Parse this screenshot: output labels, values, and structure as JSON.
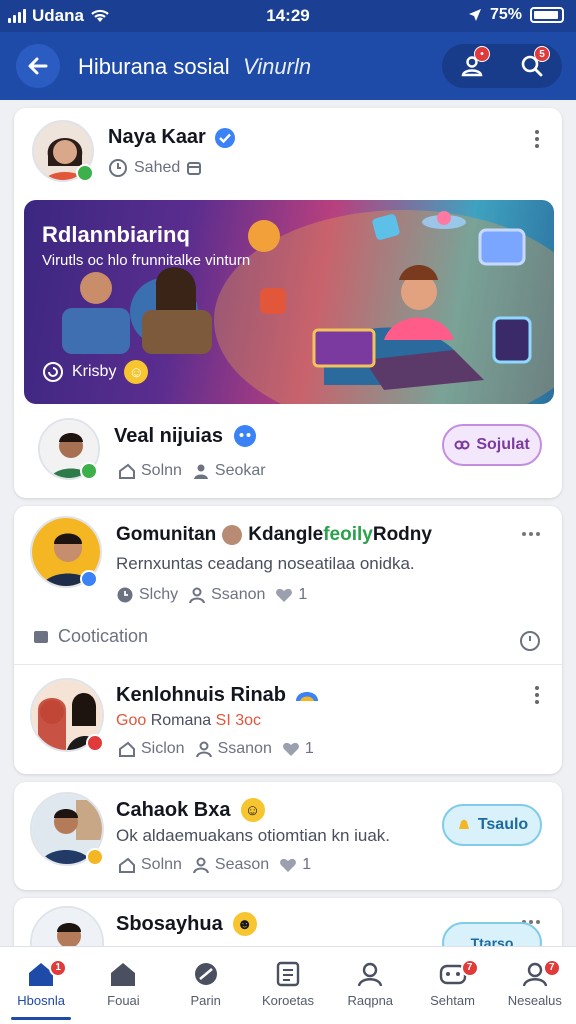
{
  "status_bar": {
    "carrier": "Udana",
    "time": "14:29",
    "battery": "75%"
  },
  "header": {
    "title": "Hiburana sosial",
    "subtitle": "Vinurln"
  },
  "post1": {
    "name": "Naya Kaar",
    "meta": "Sahed",
    "banner_title": "Rdlannbiarinq",
    "banner_subtitle": "Virutls oc hlo frunnitalke vinturn",
    "banner_footer": "Krisby"
  },
  "post2": {
    "name": "Veal nijuias",
    "button_label": "Sojulat",
    "stat1": "Solnn",
    "stat2": "Seokar"
  },
  "post3": {
    "name": "Gomunitan",
    "name_tail": "Kdangle",
    "name_highlight": "feoily",
    "name_end": "Rodny",
    "text": "Rernxuntas ceadang noseatilaa onidka.",
    "stat1": "Slchy",
    "stat2": "Ssanon",
    "likes": "1"
  },
  "section": {
    "title": "Cootication"
  },
  "post4": {
    "name": "Kenlohnuis Rinab",
    "tag_a": "Goo",
    "tag_b": "Romana",
    "tag_c": "SI 3oc",
    "stat1": "Siclon",
    "stat2": "Ssanon",
    "likes": "1"
  },
  "post5": {
    "name": "Cahaok Bxa",
    "text": "Ok aldaemuakans otiomtian kn iuak.",
    "button_label": "Tsaulo",
    "stat1": "Solnn",
    "stat2": "Season",
    "likes": "1"
  },
  "post6": {
    "name": "Sbosayhua",
    "button_label": "Ttarso"
  },
  "nav": [
    {
      "label": "Hbosnla",
      "badge": "1"
    },
    {
      "label": "Fouai",
      "badge": ""
    },
    {
      "label": "Parin",
      "badge": ""
    },
    {
      "label": "Koroetas",
      "badge": ""
    },
    {
      "label": "Raqpna",
      "badge": ""
    },
    {
      "label": "Sehtam",
      "badge": "7"
    },
    {
      "label": "Nesealus",
      "badge": "7"
    }
  ],
  "colors": {
    "primary": "#1e4aa8",
    "badge": "#e13a3a",
    "verified": "#3b82f6"
  }
}
